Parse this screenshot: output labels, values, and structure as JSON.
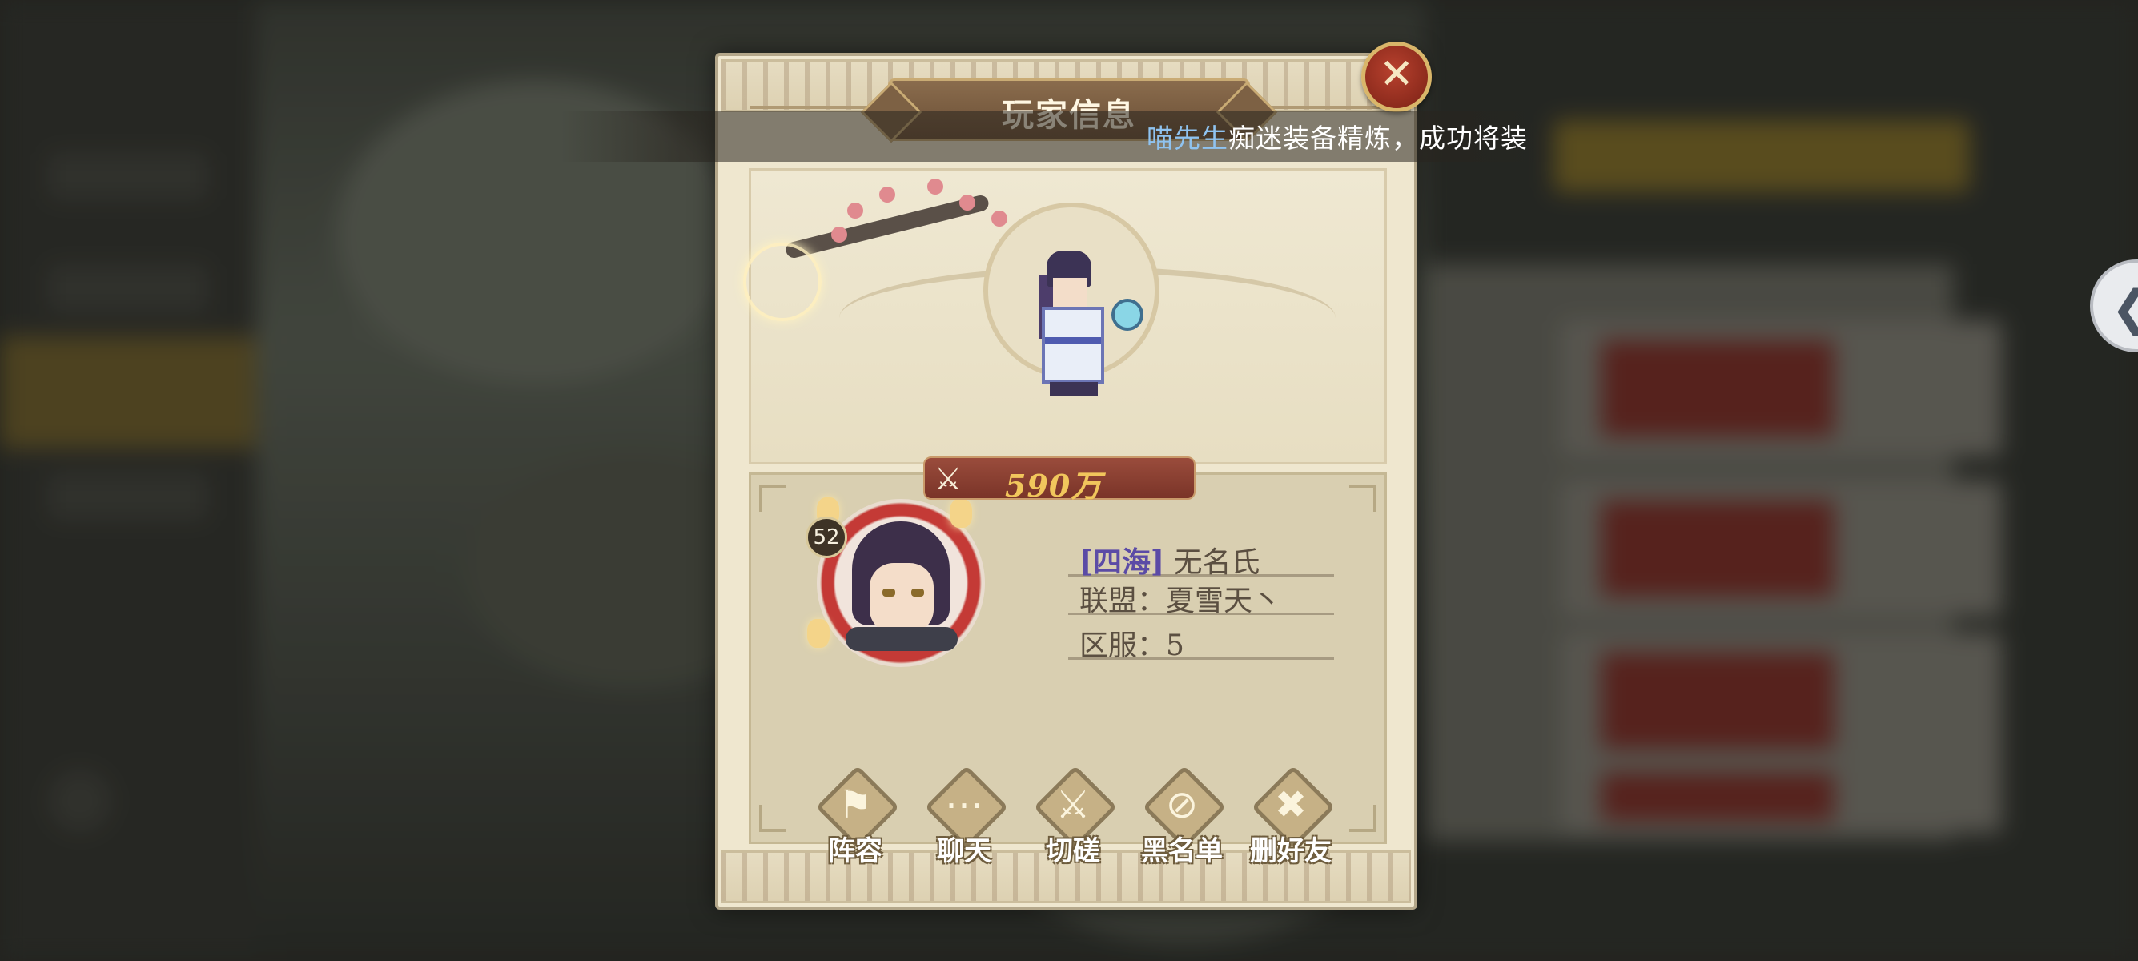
{
  "notice": {
    "player_name": "喵先生",
    "message": "痴迷装备精炼，成功将装"
  },
  "dialog": {
    "title": "玩家信息",
    "close_icon": "close-x-icon",
    "power": {
      "icon": "crossed-swords-icon",
      "value": "590万"
    },
    "player": {
      "level": "52",
      "server_tag": "[四海]",
      "name": "无名氏",
      "alliance": "联盟：夏雪天丶",
      "server": "区服：5"
    },
    "actions": [
      {
        "label": "阵容",
        "icon": "flag-icon"
      },
      {
        "label": "聊天",
        "icon": "chat-bubble-icon"
      },
      {
        "label": "切磋",
        "icon": "crossed-swords-icon"
      },
      {
        "label": "黑名单",
        "icon": "blacklist-icon"
      },
      {
        "label": "删好友",
        "icon": "delete-friend-icon"
      }
    ]
  },
  "edge_button": {
    "icon": "chevron-left-icon"
  },
  "colors": {
    "notice_name": "#8fc3f0",
    "power_value": "#f1c65c",
    "server_tag": "#5b4ba6",
    "close_button": "#a33425"
  }
}
